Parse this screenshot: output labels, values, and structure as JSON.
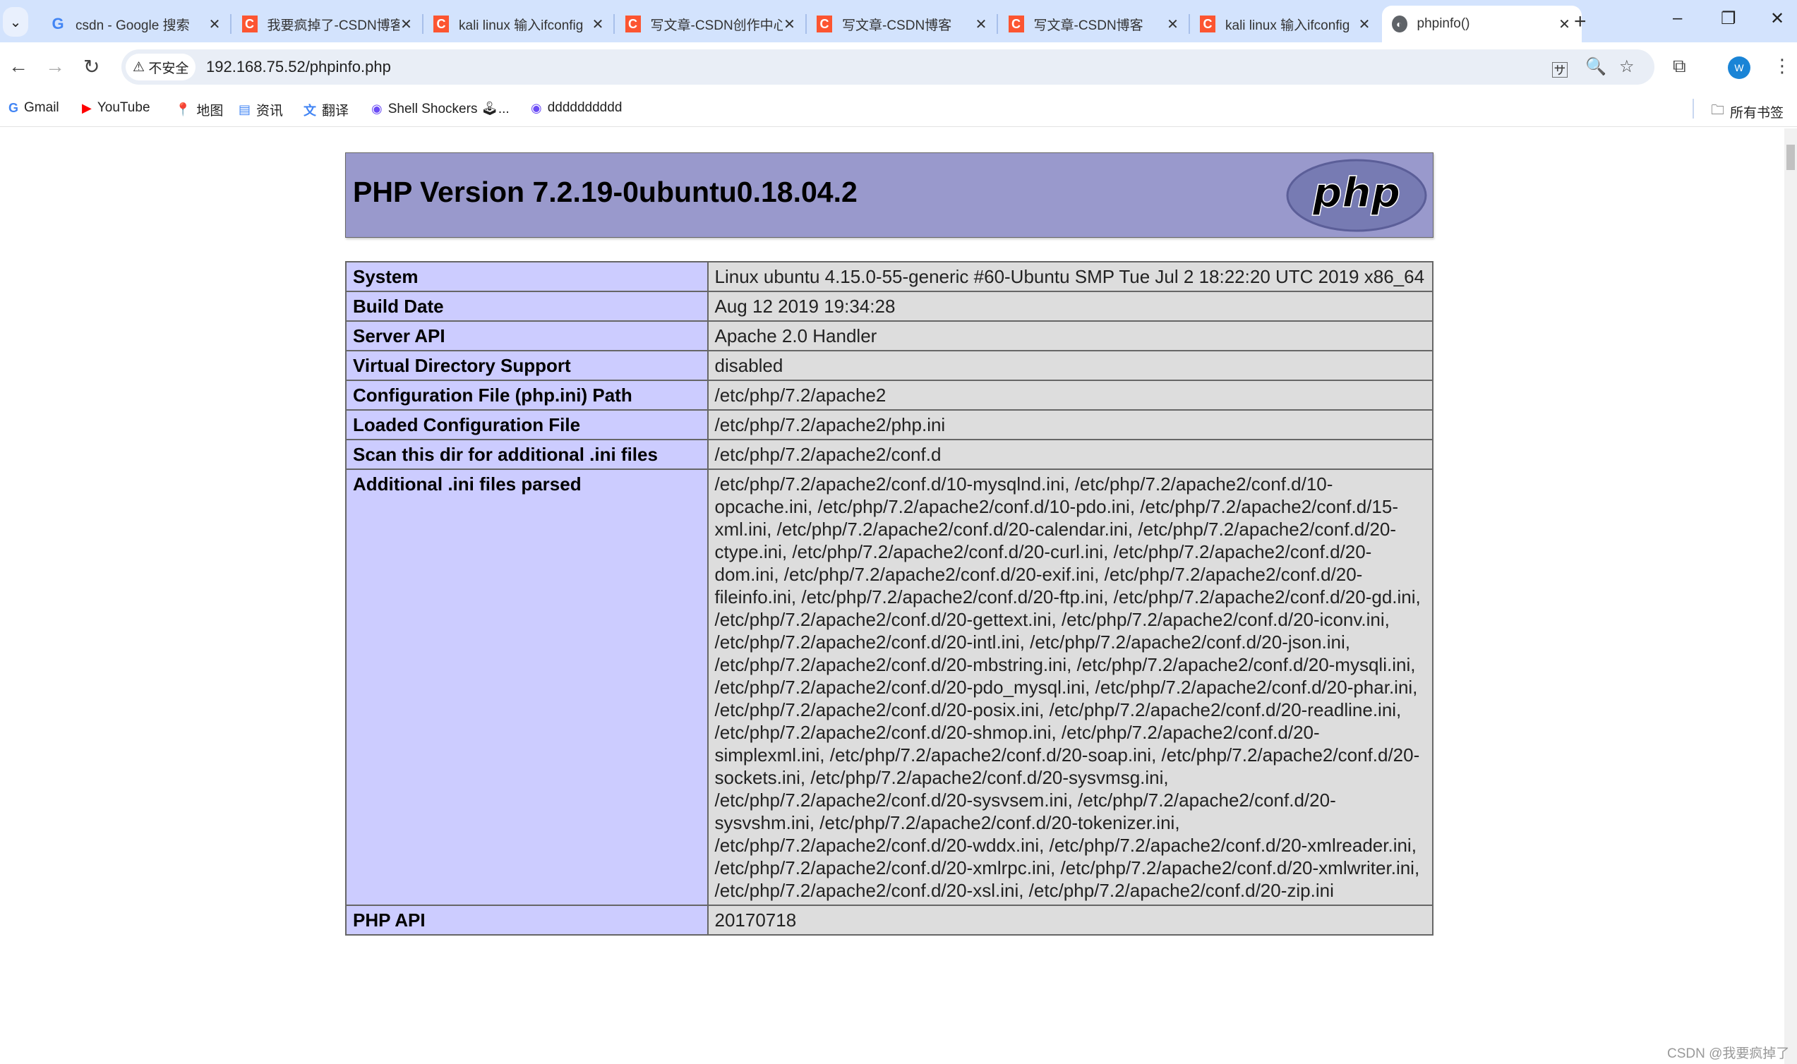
{
  "browser": {
    "tabs": [
      {
        "title": "csdn - Google 搜索",
        "icon": "google-icon"
      },
      {
        "title": "我要疯掉了-CSDN博客",
        "icon": "csdn-icon"
      },
      {
        "title": "kali linux 输入ifconfig",
        "icon": "csdn-icon"
      },
      {
        "title": "写文章-CSDN创作中心",
        "icon": "csdn-icon"
      },
      {
        "title": "写文章-CSDN博客",
        "icon": "csdn-icon"
      },
      {
        "title": "写文章-CSDN博客",
        "icon": "csdn-icon"
      },
      {
        "title": "kali linux 输入ifconfig",
        "icon": "csdn-icon"
      },
      {
        "title": "phpinfo()",
        "icon": "globe-icon",
        "active": true
      }
    ],
    "security_label": "不安全",
    "url": "192.168.75.52/phpinfo.php",
    "profile_initial": "W",
    "bookmarks": [
      {
        "label": "Gmail",
        "icon": "google-icon"
      },
      {
        "label": "YouTube",
        "icon": "youtube-icon"
      },
      {
        "label": "地图",
        "icon": "maps-icon"
      },
      {
        "label": "资讯",
        "icon": "news-icon"
      },
      {
        "label": "翻译",
        "icon": "translate-icon"
      },
      {
        "label": "Shell Shockers 🕹...",
        "icon": "shell-icon"
      },
      {
        "label": "dddddddddd",
        "icon": "shell-icon"
      }
    ],
    "all_bookmarks": "所有书签"
  },
  "page": {
    "title": "PHP Version 7.2.19-0ubuntu0.18.04.2",
    "logo_text": "php",
    "rows": [
      {
        "key": "System",
        "value": "Linux ubuntu 4.15.0-55-generic #60-Ubuntu SMP Tue Jul 2 18:22:20 UTC 2019 x86_64"
      },
      {
        "key": "Build Date",
        "value": "Aug 12 2019 19:34:28"
      },
      {
        "key": "Server API",
        "value": "Apache 2.0 Handler"
      },
      {
        "key": "Virtual Directory Support",
        "value": "disabled"
      },
      {
        "key": "Configuration File (php.ini) Path",
        "value": "/etc/php/7.2/apache2"
      },
      {
        "key": "Loaded Configuration File",
        "value": "/etc/php/7.2/apache2/php.ini"
      },
      {
        "key": "Scan this dir for additional .ini files",
        "value": "/etc/php/7.2/apache2/conf.d"
      },
      {
        "key": "Additional .ini files parsed",
        "value": "/etc/php/7.2/apache2/conf.d/10-mysqlnd.ini, /etc/php/7.2/apache2/conf.d/10-opcache.ini, /etc/php/7.2/apache2/conf.d/10-pdo.ini, /etc/php/7.2/apache2/conf.d/15-xml.ini, /etc/php/7.2/apache2/conf.d/20-calendar.ini, /etc/php/7.2/apache2/conf.d/20-ctype.ini, /etc/php/7.2/apache2/conf.d/20-curl.ini, /etc/php/7.2/apache2/conf.d/20-dom.ini, /etc/php/7.2/apache2/conf.d/20-exif.ini, /etc/php/7.2/apache2/conf.d/20-fileinfo.ini, /etc/php/7.2/apache2/conf.d/20-ftp.ini, /etc/php/7.2/apache2/conf.d/20-gd.ini, /etc/php/7.2/apache2/conf.d/20-gettext.ini, /etc/php/7.2/apache2/conf.d/20-iconv.ini, /etc/php/7.2/apache2/conf.d/20-intl.ini, /etc/php/7.2/apache2/conf.d/20-json.ini, /etc/php/7.2/apache2/conf.d/20-mbstring.ini, /etc/php/7.2/apache2/conf.d/20-mysqli.ini, /etc/php/7.2/apache2/conf.d/20-pdo_mysql.ini, /etc/php/7.2/apache2/conf.d/20-phar.ini, /etc/php/7.2/apache2/conf.d/20-posix.ini, /etc/php/7.2/apache2/conf.d/20-readline.ini, /etc/php/7.2/apache2/conf.d/20-shmop.ini, /etc/php/7.2/apache2/conf.d/20-simplexml.ini, /etc/php/7.2/apache2/conf.d/20-soap.ini, /etc/php/7.2/apache2/conf.d/20-sockets.ini, /etc/php/7.2/apache2/conf.d/20-sysvmsg.ini, /etc/php/7.2/apache2/conf.d/20-sysvsem.ini, /etc/php/7.2/apache2/conf.d/20-sysvshm.ini, /etc/php/7.2/apache2/conf.d/20-tokenizer.ini, /etc/php/7.2/apache2/conf.d/20-wddx.ini, /etc/php/7.2/apache2/conf.d/20-xmlreader.ini, /etc/php/7.2/apache2/conf.d/20-xmlrpc.ini, /etc/php/7.2/apache2/conf.d/20-xmlwriter.ini, /etc/php/7.2/apache2/conf.d/20-xsl.ini, /etc/php/7.2/apache2/conf.d/20-zip.ini"
      },
      {
        "key": "PHP API",
        "value": "20170718"
      }
    ]
  },
  "watermark": "CSDN @我要疯掉了",
  "colors": {
    "header_bg": "#9999cc",
    "key_bg": "#ccccff",
    "value_bg": "#dddddd",
    "tabbar_bg": "#d3e3fd",
    "csdn_brand": "#fc5531"
  }
}
